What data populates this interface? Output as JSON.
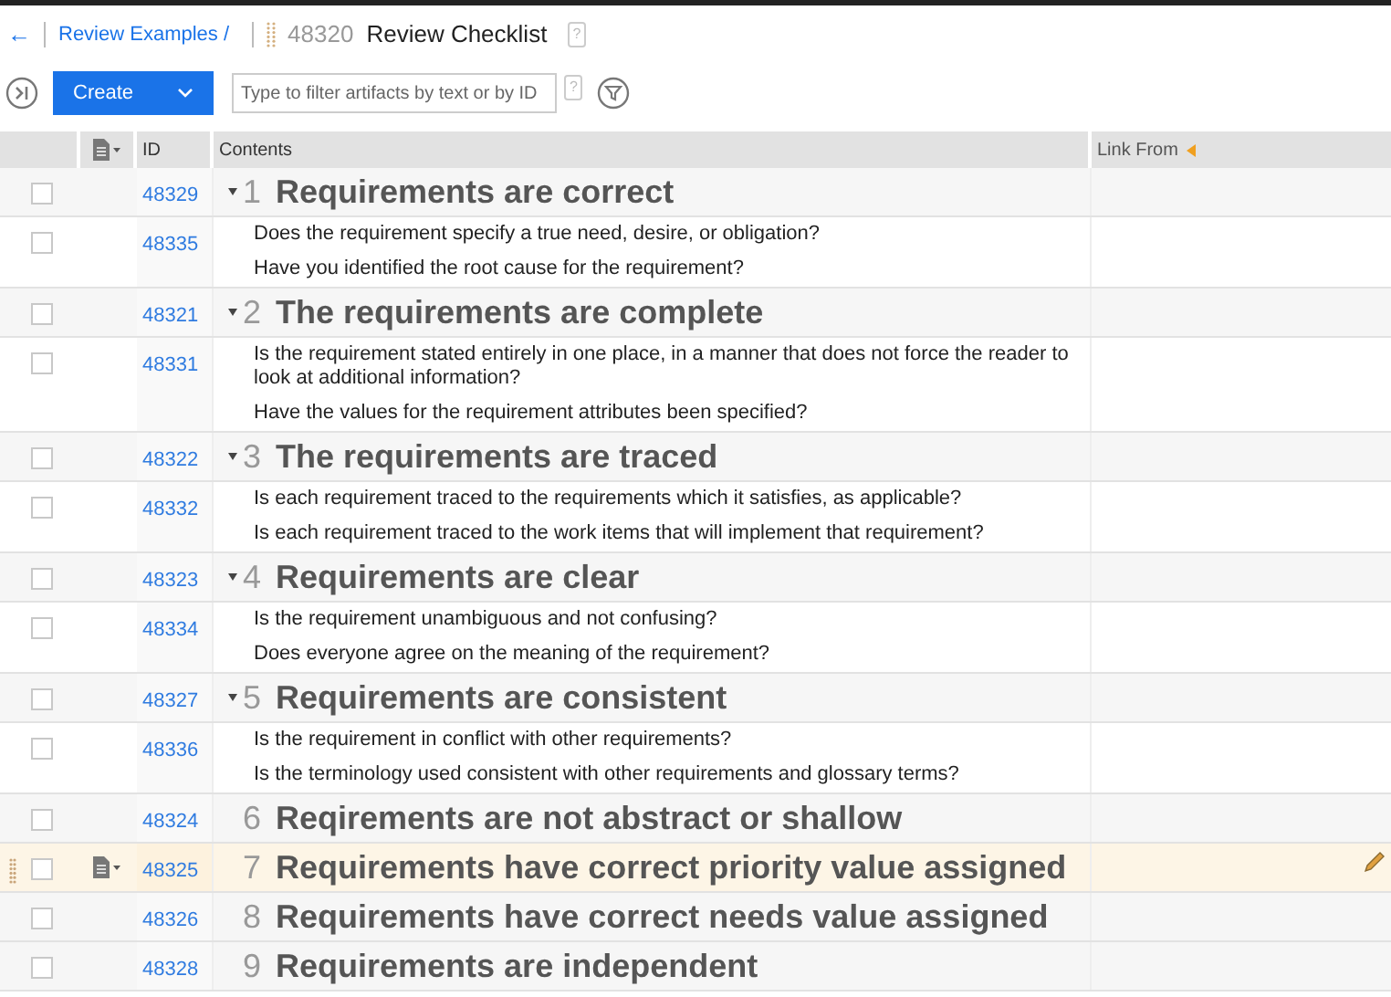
{
  "breadcrumb": {
    "back": "←",
    "parent": "Review Examples /",
    "id": "48320",
    "title": "Review Checklist",
    "help": "?"
  },
  "toolbar": {
    "create": "Create",
    "filter": {
      "placeholder": "Type to filter artifacts by text or by ID"
    },
    "help": "?"
  },
  "table": {
    "columns": [
      "ID",
      "Contents",
      "Link From"
    ],
    "rows": [
      {
        "kind": "heading",
        "id": "48329",
        "number": "1",
        "title": "Requirements are correct",
        "expanded": true,
        "checked": false,
        "selected": false
      },
      {
        "kind": "questions",
        "id": "48335",
        "lines": [
          "Does the requirement specify a true need, desire, or obligation?",
          "Have you identified the root cause for the requirement?"
        ],
        "checked": false,
        "selected": false
      },
      {
        "kind": "heading",
        "id": "48321",
        "number": "2",
        "title": "The requirements are complete",
        "expanded": true,
        "checked": false,
        "selected": false
      },
      {
        "kind": "questions",
        "id": "48331",
        "lines": [
          "Is the requirement stated entirely in one place, in a manner that does not force the reader to look at additional information?",
          "Have the values for the requirement attributes been specified?"
        ],
        "checked": false,
        "selected": false
      },
      {
        "kind": "heading",
        "id": "48322",
        "number": "3",
        "title": "The requirements are traced",
        "expanded": true,
        "checked": false,
        "selected": false
      },
      {
        "kind": "questions",
        "id": "48332",
        "lines": [
          "Is each requirement traced to the requirements which it satisfies, as applicable?",
          "Is each requirement traced to the work items that will implement that requirement?"
        ],
        "checked": false,
        "selected": false
      },
      {
        "kind": "heading",
        "id": "48323",
        "number": "4",
        "title": "Requirements are clear",
        "expanded": true,
        "checked": false,
        "selected": false
      },
      {
        "kind": "questions",
        "id": "48334",
        "lines": [
          "Is the requirement unambiguous and not confusing?",
          "Does everyone agree on the meaning of the requirement?"
        ],
        "checked": false,
        "selected": false
      },
      {
        "kind": "heading",
        "id": "48327",
        "number": "5",
        "title": "Requirements are consistent",
        "expanded": true,
        "checked": false,
        "selected": false
      },
      {
        "kind": "questions",
        "id": "48336",
        "lines": [
          "Is the requirement in conflict with other requirements?",
          "Is the terminology used consistent with other requirements and glossary terms?"
        ],
        "checked": false,
        "selected": false
      },
      {
        "kind": "heading",
        "id": "48324",
        "number": "6",
        "title": "Reqirements are not abstract or shallow",
        "checked": false,
        "selected": false
      },
      {
        "kind": "heading",
        "id": "48325",
        "number": "7",
        "title": "Requirements have correct priority value assigned",
        "checked": false,
        "selected": true
      },
      {
        "kind": "heading",
        "id": "48326",
        "number": "8",
        "title": "Requirements have correct needs value assigned",
        "checked": false,
        "selected": false
      },
      {
        "kind": "heading",
        "id": "48328",
        "number": "9",
        "title": "Requirements are independent",
        "checked": false,
        "selected": false
      }
    ]
  }
}
